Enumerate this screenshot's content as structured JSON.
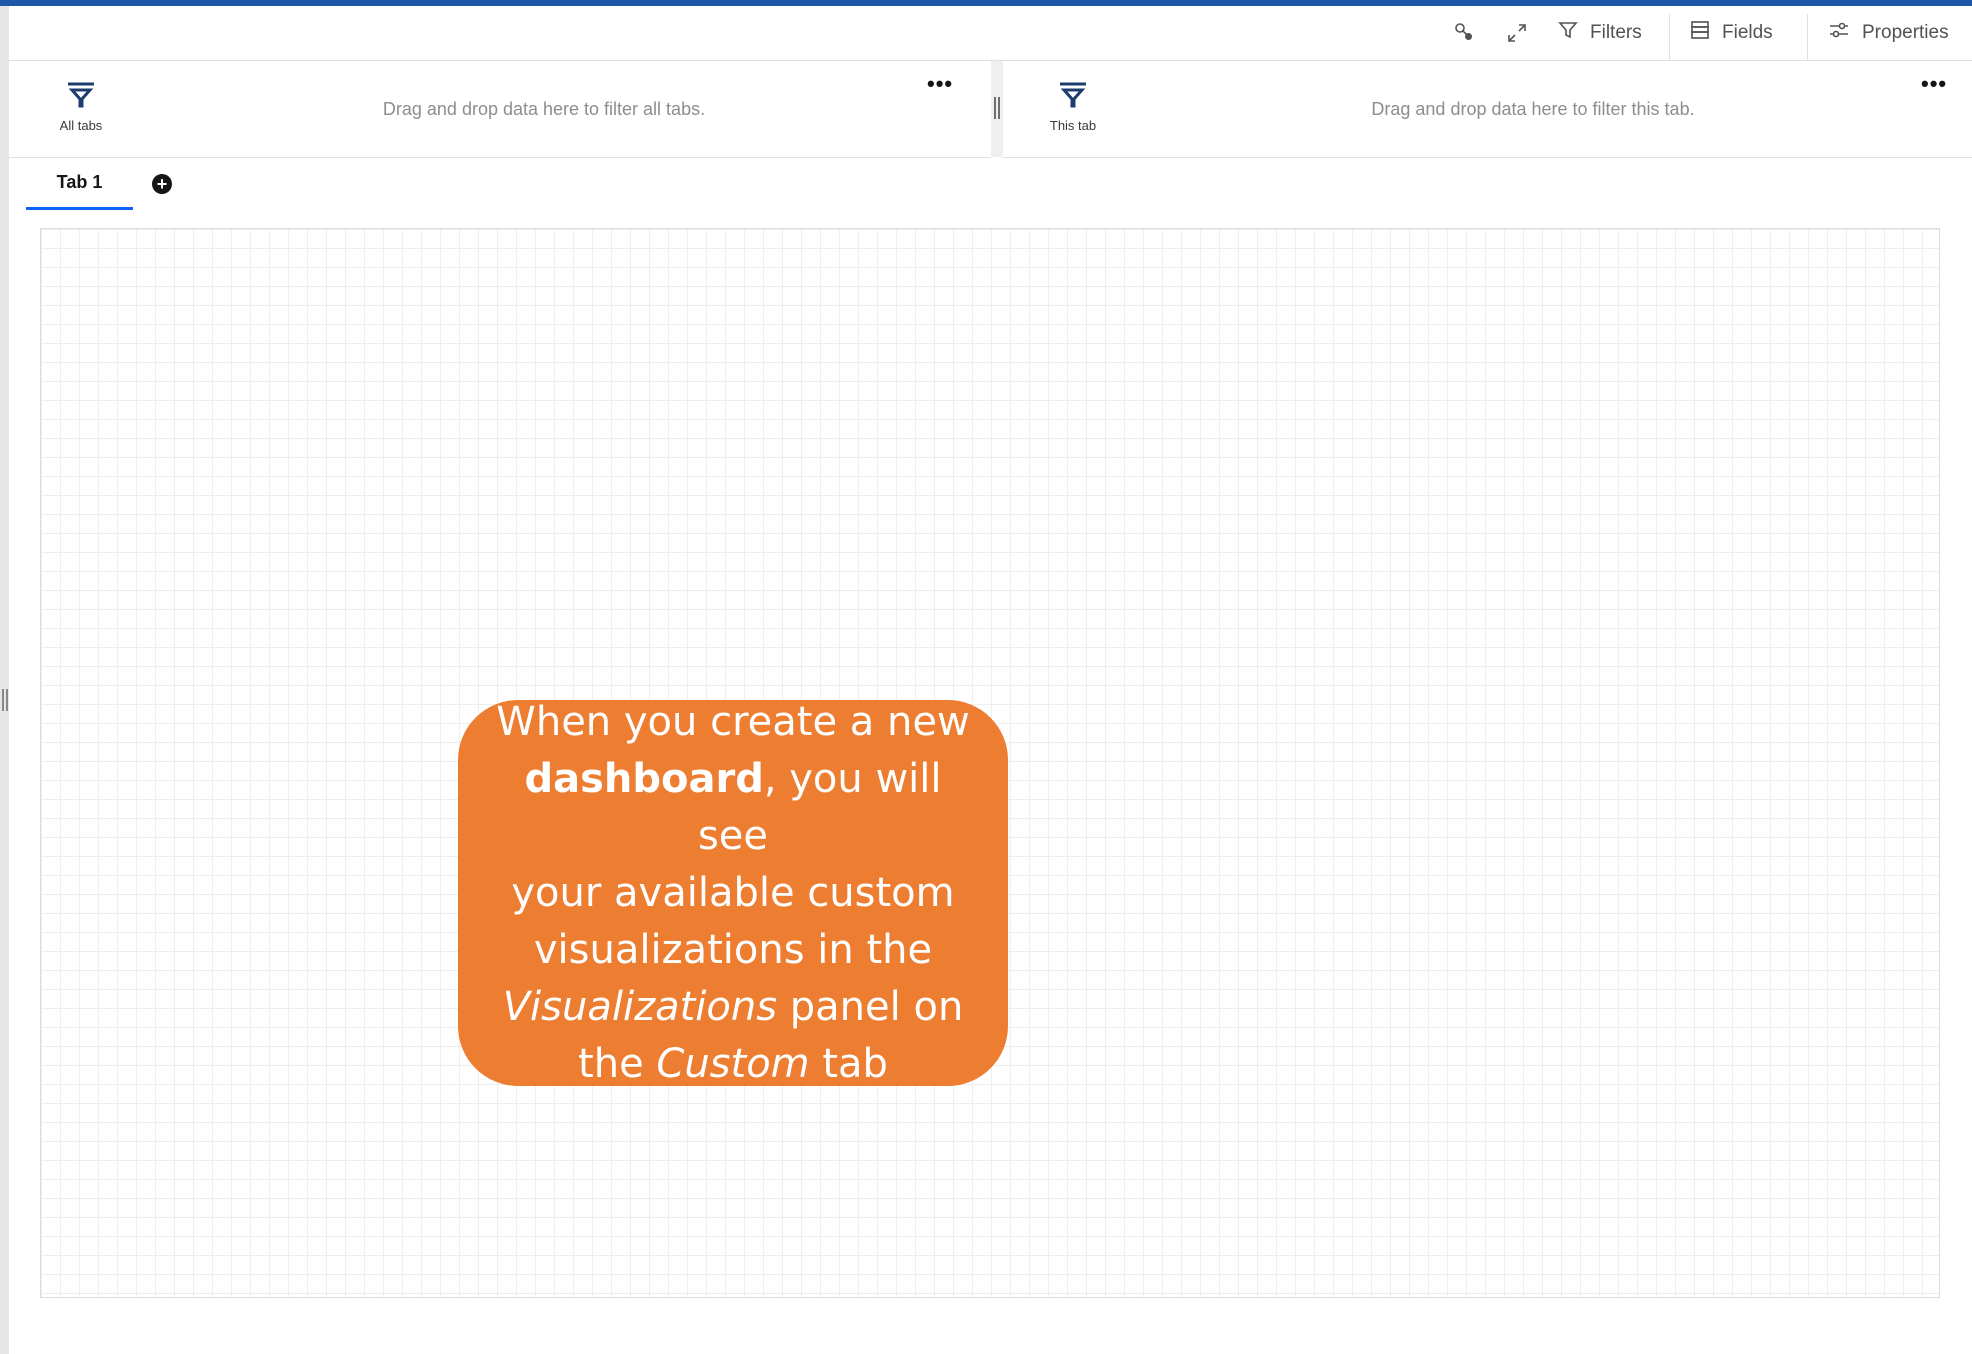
{
  "toolbar": {
    "filters_label": "Filters",
    "fields_label": "Fields",
    "properties_label": "Properties",
    "icons": [
      "link-icon",
      "expand-icon",
      "filter-icon",
      "fields-icon",
      "sliders-icon"
    ]
  },
  "filter_bar": {
    "all_tabs": {
      "label": "All tabs",
      "hint": "Drag and drop data here to filter all tabs.",
      "more": "•••"
    },
    "this_tab": {
      "label": "This tab",
      "hint": "Drag and drop data here to filter this tab.",
      "more": "•••"
    }
  },
  "tabs": {
    "items": [
      {
        "label": "Tab 1",
        "active": true
      }
    ],
    "add_label": "+"
  },
  "callout": {
    "line1": "When you create a new",
    "bold_word": "dashboard",
    "line2_rest": ", you will see",
    "line3": "your available custom",
    "line4": "visualizations in the",
    "italic_visualizations": "Visualizations",
    "line5_rest": " panel on",
    "line6_pre": "the ",
    "italic_custom": "Custom",
    "line6_post": " tab"
  },
  "colors": {
    "accent_bar": "#1e56a8",
    "callout_bg": "#ed7d31",
    "tab_underline": "#0f62fe"
  }
}
